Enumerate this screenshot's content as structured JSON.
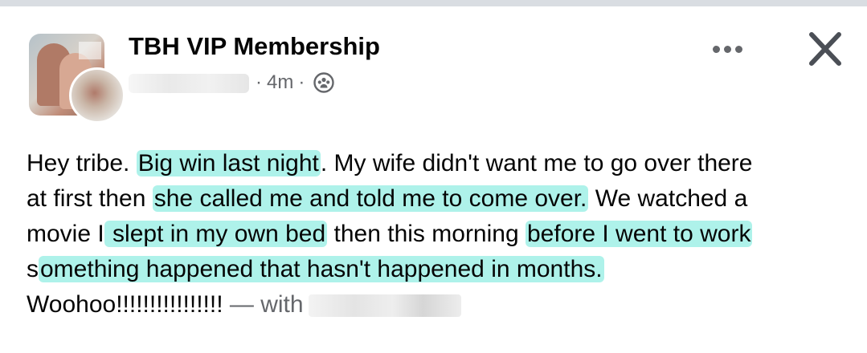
{
  "post": {
    "group_name": "TBH VIP Membership",
    "time": "4m",
    "separator": "·",
    "privacy_icon": "group-members-icon",
    "more_icon": "more-options-icon",
    "close_icon": "close-icon"
  },
  "body": {
    "l1_a": "Hey tribe. ",
    "l1_hl": "Big win last night",
    "l1_b": ". My wife didn't want me to go over there",
    "l2_a": "at first then ",
    "l2_hl": "she called me and told me to come over.",
    "l2_b": " We watched a",
    "l3_a": "movie I",
    "l3_hl1": " slept in my own bed",
    "l3_b": " then this morning ",
    "l3_hl2": "before I went to work",
    "l4_a": "s",
    "l4_hl": "omething happened that hasn't happened in months.",
    "l5_text": "Woohoo!!!!!!!!!!!!!!!! ",
    "l5_with": "— with"
  },
  "colors": {
    "highlight": "#78eadc",
    "meta_text": "#65676b",
    "text": "#050505"
  }
}
